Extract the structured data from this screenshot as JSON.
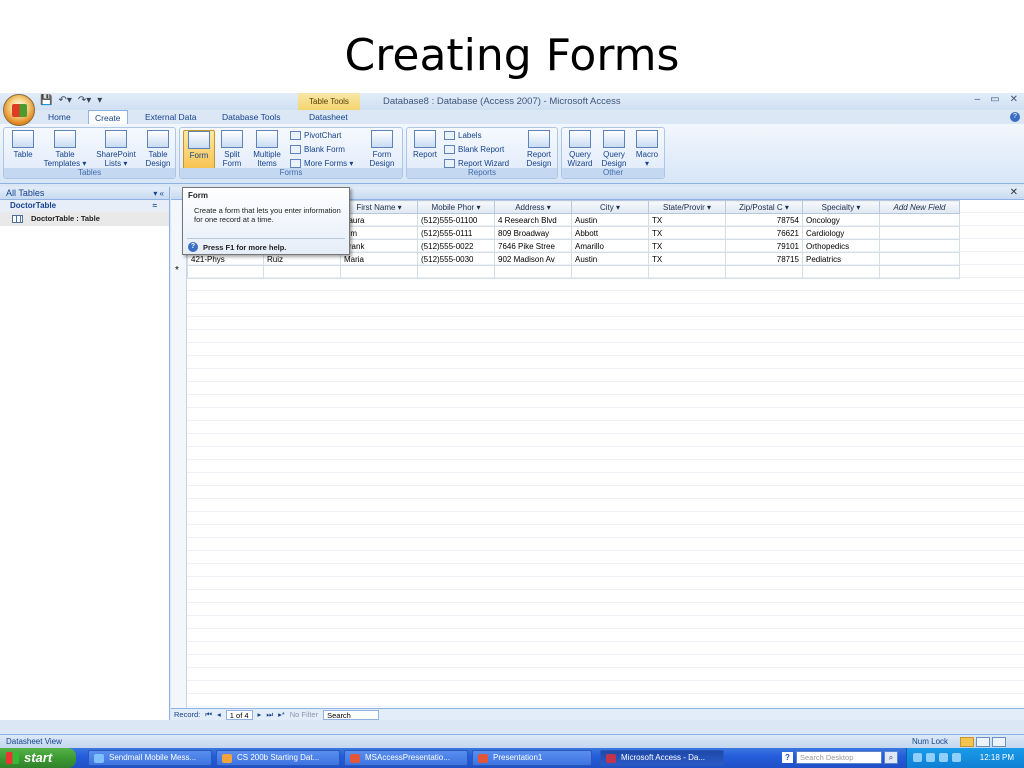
{
  "slide": {
    "title": "Creating Forms"
  },
  "window": {
    "context_tab": "Table Tools",
    "title": "Database8 : Database (Access 2007) - Microsoft Access",
    "controls": {
      "minimize": "–",
      "maximize": "▭",
      "close": "✕"
    }
  },
  "tabs": [
    {
      "label": "Home"
    },
    {
      "label": "Create"
    },
    {
      "label": "External Data"
    },
    {
      "label": "Database Tools"
    },
    {
      "label": "Datasheet"
    }
  ],
  "ribbon": {
    "tables": {
      "label": "Tables",
      "table": "Table",
      "table_templates_1": "Table",
      "table_templates_2": "Templates ▾",
      "sharepoint_1": "SharePoint",
      "sharepoint_2": "Lists ▾",
      "table_design_1": "Table",
      "table_design_2": "Design"
    },
    "forms": {
      "label": "Forms",
      "form": "Form",
      "split_1": "Split",
      "split_2": "Form",
      "multiple_1": "Multiple",
      "multiple_2": "Items",
      "pivotchart": "PivotChart",
      "blank_form": "Blank Form",
      "more_forms": "More Forms ▾",
      "form_design_1": "Form",
      "form_design_2": "Design"
    },
    "reports": {
      "label": "Reports",
      "report": "Report",
      "labels": "Labels",
      "blank_report": "Blank Report",
      "report_wizard": "Report Wizard",
      "report_design_1": "Report",
      "report_design_2": "Design"
    },
    "other": {
      "label": "Other",
      "query_wizard_1": "Query",
      "query_wizard_2": "Wizard",
      "query_design_1": "Query",
      "query_design_2": "Design",
      "macro_1": "Macro",
      "macro_2": "▾"
    }
  },
  "nav": {
    "header": "All Tables",
    "header_ctl": "▾  «",
    "group": "DoctorTable",
    "group_ctl": "≈",
    "items": [
      {
        "label": "DoctorTable : Table"
      }
    ]
  },
  "tooltip": {
    "title": "Form",
    "body": "Create a form that lets you enter information for one record at a time.",
    "help": "Press F1 for more help."
  },
  "datasheet": {
    "columns": [
      "",
      "",
      "First Name ▾",
      "Mobile Phor ▾",
      "Address ▾",
      "City ▾",
      "State/Provir ▾",
      "Zip/Postal C ▾",
      "Specialty ▾",
      "Add New Field"
    ],
    "rows": [
      [
        "",
        "",
        "Laura",
        "(512)555-01100",
        "4 Research Blvd",
        "Austin",
        "TX",
        "78754",
        "Oncology",
        ""
      ],
      [
        "",
        "",
        "Tim",
        "(512)555-0111",
        "809 Broadway",
        "Abbott",
        "TX",
        "76621",
        "Cardiology",
        ""
      ],
      [
        "",
        "",
        "Frank",
        "(512)555-0022",
        "7646 Pike Stree",
        "Amarillo",
        "TX",
        "79101",
        "Orthopedics",
        ""
      ],
      [
        "421-Phys",
        "Ruiz",
        "Maria",
        "(512)555-0030",
        "902 Madison Av",
        "Austin",
        "TX",
        "78715",
        "Pediatrics",
        ""
      ]
    ],
    "new_row_marker": "*"
  },
  "record_nav": {
    "label": "Record:",
    "first": "⏮",
    "prev": "◂",
    "current": "1 of 4",
    "next": "▸",
    "last": "⏭",
    "new": "▸*",
    "filter": "No Filter",
    "search": "Search"
  },
  "status": {
    "view": "Datasheet View",
    "numlock": "Num Lock"
  },
  "taskbar": {
    "start": "start",
    "items": [
      {
        "label": "Sendmail Mobile Mess..."
      },
      {
        "label": "CS 200b Starting Dat..."
      },
      {
        "label": "MSAccessPresentatio..."
      },
      {
        "label": "Presentation1"
      },
      {
        "label": "Microsoft Access - Da..."
      }
    ],
    "search_placeholder": "Search Desktop",
    "clock": "12:18 PM"
  }
}
